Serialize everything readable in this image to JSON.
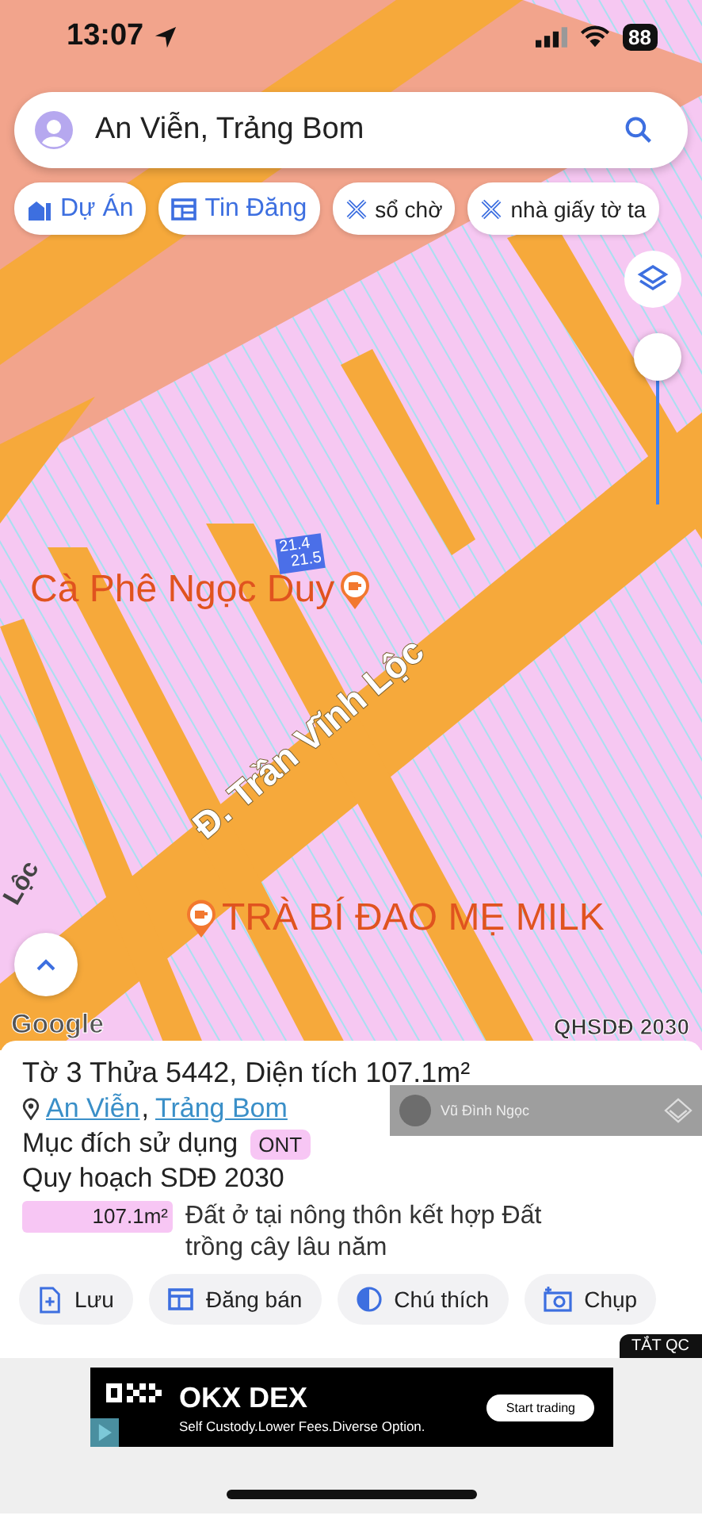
{
  "status_bar": {
    "time": "13:07",
    "battery": "88"
  },
  "search": {
    "value": "An Viễn, Trảng Bom"
  },
  "chips": [
    {
      "label": "Dự Án",
      "kind": "project"
    },
    {
      "label": "Tin Đăng",
      "kind": "listing"
    },
    {
      "label": "sổ chờ",
      "kind": "tag"
    },
    {
      "label": "nhà giấy tờ ta",
      "kind": "tag"
    }
  ],
  "opacity_slider": {
    "level": 1
  },
  "map": {
    "plot_labels": [
      "21.4",
      "21.5"
    ],
    "places": [
      {
        "text": "Cà Phê Ngọc Duy",
        "kind": "cafe-right"
      },
      {
        "text": "TRÀ BÍ ĐAO MẸ MILK",
        "kind": "cafe-left"
      }
    ],
    "road": "Đ. Trần Vĩnh Lộc",
    "road_fragment": "Lộc",
    "attribution": "Google",
    "layer_badge": "QHSDĐ 2030"
  },
  "parcel": {
    "title": "Tờ 3 Thửa 5442, Diện tích 107.1m²",
    "location_links": [
      "An Viễn",
      "Trảng Bom"
    ],
    "location_separator": ",",
    "purpose_label": "Mục đích sử dụng",
    "purpose_code": "ONT",
    "plan_title": "Quy hoạch SDĐ 2030",
    "plan_rows": [
      {
        "area": "107.1m²",
        "description": "Đất ở tại nông thôn kết hợp Đất trồng cây lâu năm"
      }
    ]
  },
  "overlay_user": {
    "name": "Vũ Đình Ngọc"
  },
  "actions": [
    {
      "label": "Lưu",
      "kind": "save"
    },
    {
      "label": "Đăng bán",
      "kind": "listing"
    },
    {
      "label": "Chú thích",
      "kind": "legend"
    },
    {
      "label": "Chụp",
      "kind": "camera"
    }
  ],
  "ad_close": "TẮT QC",
  "ad": {
    "brand": "OKX DEX",
    "tagline": "Self Custody.Lower Fees.Diverse Option.",
    "button": "Start trading"
  }
}
